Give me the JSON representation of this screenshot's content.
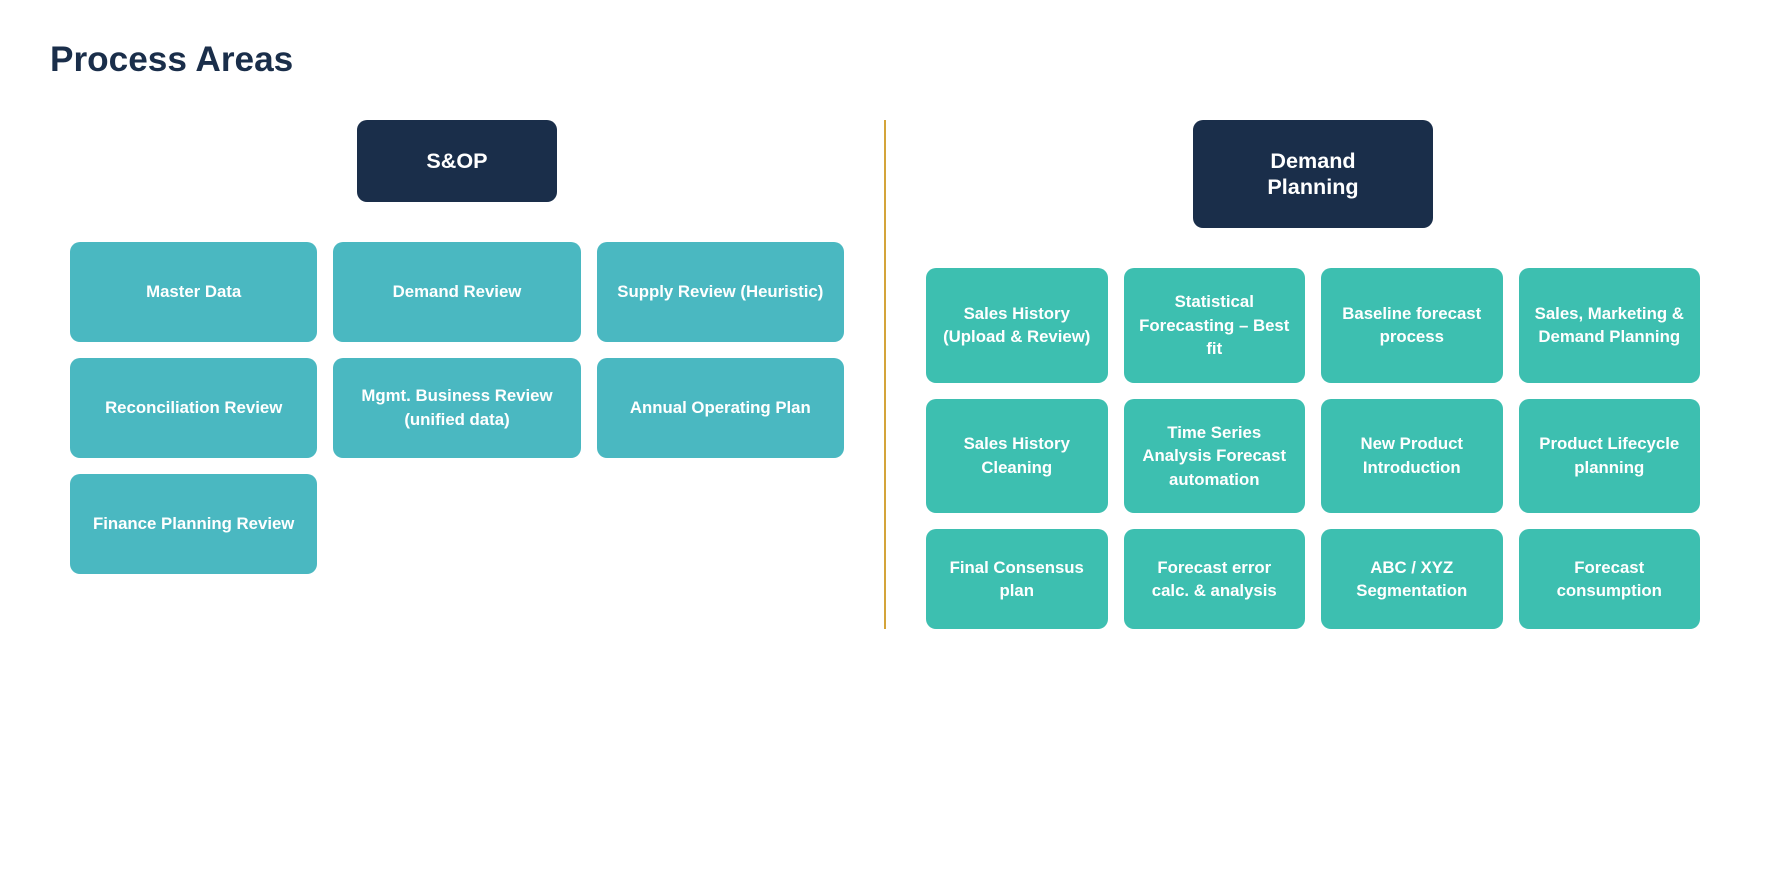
{
  "page": {
    "title": "Process Areas"
  },
  "left": {
    "header": "S&OP",
    "rows": [
      [
        {
          "label": "Master Data"
        },
        {
          "label": "Demand Review"
        },
        {
          "label": "Supply Review (Heuristic)"
        }
      ],
      [
        {
          "label": "Reconciliation Review"
        },
        {
          "label": "Mgmt. Business Review (unified data)"
        },
        {
          "label": "Annual Operating Plan"
        }
      ],
      [
        {
          "label": "Finance Planning Review"
        }
      ]
    ]
  },
  "right": {
    "header": "Demand Planning",
    "rows": [
      [
        {
          "label": "Sales History (Upload & Review)"
        },
        {
          "label": "Statistical Forecasting – Best fit"
        },
        {
          "label": "Baseline forecast process"
        },
        {
          "label": "Sales, Marketing & Demand Planning"
        }
      ],
      [
        {
          "label": "Sales History Cleaning"
        },
        {
          "label": "Time Series Analysis Forecast automation"
        },
        {
          "label": "New Product Introduction"
        },
        {
          "label": "Product Lifecycle planning"
        }
      ],
      [
        {
          "label": "Final Consensus plan"
        },
        {
          "label": "Forecast error calc. & analysis"
        },
        {
          "label": "ABC / XYZ Segmentation"
        },
        {
          "label": "Forecast consumption"
        }
      ]
    ]
  }
}
